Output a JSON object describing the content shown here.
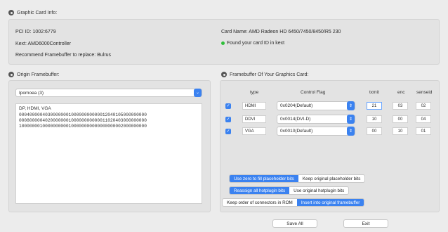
{
  "graphic_card_info": {
    "title": "Graphic Card Info:",
    "pci_id": "PCI ID: 1002:6779",
    "kext": "Kext:  AMD6000Controller",
    "recommend": "Recommend Framebuffer to replace: Bulrus",
    "card_name": "Card Name: AMD Radeon HD 6450/7450/8450/R5 230",
    "status": "Found your card ID in kext",
    "status_color": "#2fbf3a"
  },
  "origin_framebuffer": {
    "title": "Origin Framebuffer:",
    "selected": "Ipomoea (3)",
    "text_header": "DP, HDMI, VGA",
    "hex_lines": [
      "0004000004030000000100000000000012040105000000000",
      "0008000004020000000100000000000011020403000000000",
      "1000000010000000000100000000000000000002000000000"
    ]
  },
  "framebuffer_card": {
    "title": "Framebuffer Of Your Graphics Card:",
    "columns": {
      "type": "type",
      "control_flag": "Control Flag",
      "txmit": "txmit",
      "enc": "enc",
      "senseid": "senseid"
    },
    "rows": [
      {
        "type": "HDMI",
        "flag": "0x0204(Default)",
        "txmit": "21",
        "enc": "03",
        "senseid": "02"
      },
      {
        "type": "DDVI",
        "flag": "0x0014(DVI-D)",
        "txmit": "10",
        "enc": "00",
        "senseid": "04"
      },
      {
        "type": "VGA",
        "flag": "0x0010(Default)",
        "txmit": "00",
        "enc": "10",
        "senseid": "01"
      }
    ]
  },
  "options": {
    "placeholder": {
      "on": "Use zero to fill placeholder bits",
      "off": "Keep original placeholder bits"
    },
    "hotplug": {
      "on": "Reassign all hotplugin bits",
      "off": "Use original hotplugin bits"
    },
    "connectors": {
      "off": "Keep order of connectors in ROM",
      "on": "Insert into original framebuffer"
    }
  },
  "buttons": {
    "save_all": "Save All",
    "exit": "Exit"
  },
  "colors": {
    "accent": "#3b82f0",
    "panel": "#e3e3e3",
    "window": "#ececec"
  }
}
